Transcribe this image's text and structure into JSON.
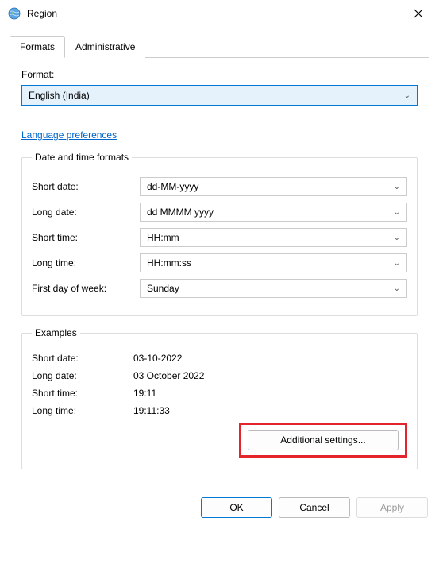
{
  "window": {
    "title": "Region"
  },
  "tabs": {
    "formats": "Formats",
    "administrative": "Administrative"
  },
  "format_section": {
    "label": "Format:",
    "selected": "English (India)"
  },
  "link": "Language preferences",
  "datetime_group": {
    "legend": "Date and time formats",
    "rows": {
      "short_date": {
        "label": "Short date:",
        "value": "dd-MM-yyyy"
      },
      "long_date": {
        "label": "Long date:",
        "value": "dd MMMM yyyy"
      },
      "short_time": {
        "label": "Short time:",
        "value": "HH:mm"
      },
      "long_time": {
        "label": "Long time:",
        "value": "HH:mm:ss"
      },
      "first_day": {
        "label": "First day of week:",
        "value": "Sunday"
      }
    }
  },
  "examples_group": {
    "legend": "Examples",
    "rows": {
      "short_date": {
        "label": "Short date:",
        "value": "03-10-2022"
      },
      "long_date": {
        "label": "Long date:",
        "value": "03 October 2022"
      },
      "short_time": {
        "label": "Short time:",
        "value": "19:11"
      },
      "long_time": {
        "label": "Long time:",
        "value": "19:11:33"
      }
    },
    "additional_button": "Additional settings..."
  },
  "buttons": {
    "ok": "OK",
    "cancel": "Cancel",
    "apply": "Apply"
  }
}
